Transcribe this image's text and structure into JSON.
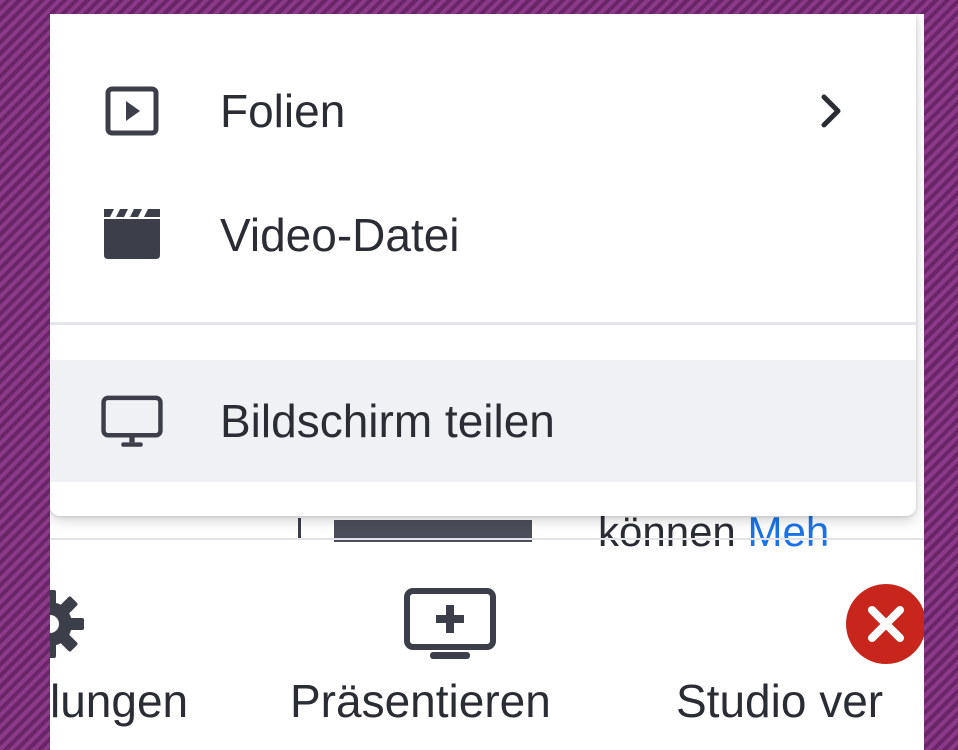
{
  "menu": {
    "items": [
      {
        "label": "Folien",
        "icon": "play-slides-icon",
        "has_submenu": true
      },
      {
        "label": "Video-Datei",
        "icon": "clapperboard-icon",
        "has_submenu": false
      },
      {
        "label": "Bildschirm teilen",
        "icon": "monitor-icon",
        "has_submenu": false,
        "highlighted": true
      }
    ]
  },
  "background_content": {
    "text": "können",
    "link_text": "Meh"
  },
  "toolbar": {
    "settings_label": "lungen",
    "present_label": "Präsentieren",
    "studio_label": "Studio ver"
  },
  "colors": {
    "text": "#2b2d35",
    "highlight": "#f0f1f5",
    "link": "#1a73e8",
    "danger": "#c8261c",
    "background": "#7a2d78"
  }
}
